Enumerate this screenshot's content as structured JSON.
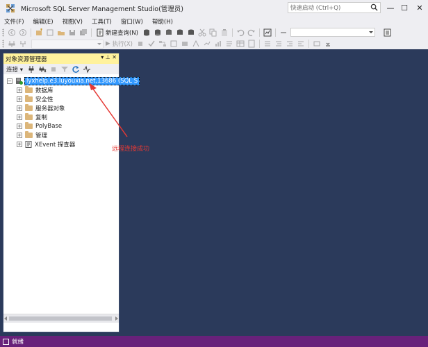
{
  "window": {
    "title": "Microsoft SQL Server Management Studio(管理员)",
    "quick_launch_placeholder": "快速启动 (Ctrl+Q)",
    "minimize": "—",
    "maximize": "☐",
    "close": "✕"
  },
  "menu": [
    "文件(F)",
    "编辑(E)",
    "视图(V)",
    "工具(T)",
    "窗口(W)",
    "帮助(H)"
  ],
  "toolbar": {
    "new_query_label": "新建查询(N)",
    "execute_label": "执行(X)"
  },
  "object_explorer": {
    "title": "对象资源管理器",
    "pin": "▾ ⊥ ✕",
    "connect_label": "连接 ▾",
    "server_node": "lyxhelp.e3.luyouxia.net,13686 (SQL S",
    "nodes": [
      {
        "label": "数据库"
      },
      {
        "label": "安全性"
      },
      {
        "label": "服务器对象"
      },
      {
        "label": "复制"
      },
      {
        "label": "PolyBase"
      },
      {
        "label": "管理"
      },
      {
        "label": "XEvent 探查器"
      }
    ]
  },
  "annotation": {
    "text": "远程连接成功",
    "color": "#e53935"
  },
  "status": {
    "text": "就绪",
    "bar_color": "#68217a"
  }
}
